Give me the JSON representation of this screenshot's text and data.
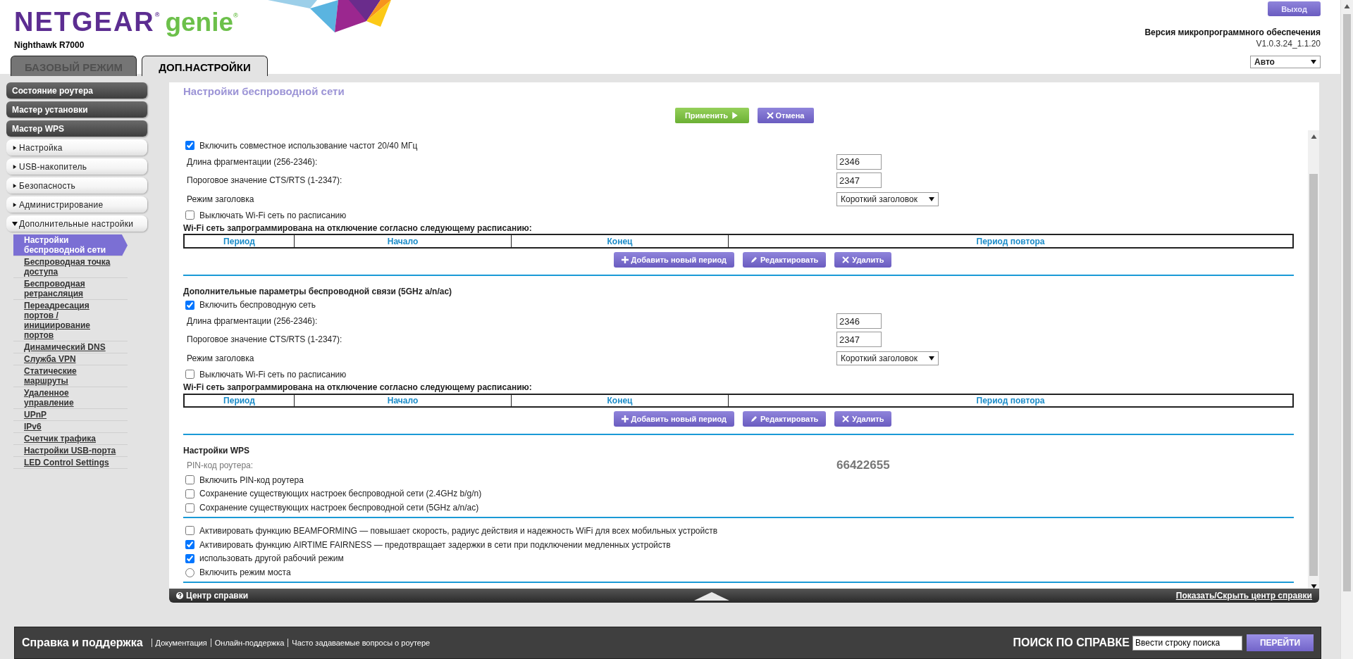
{
  "header": {
    "brand": "NETGEAR$^{®}$",
    "product": "genie$^{®}$",
    "model": "Nighthawk R7000",
    "logout": "Выход",
    "firmware_label": "Версия микропрограммного обеспечения",
    "firmware_version": "V1.0.3.24_1.1.20",
    "language": "Авто"
  },
  "tabs": [
    {
      "label": "БАЗОВЫЙ РЕЖИМ",
      "selected": false
    },
    {
      "label": "ДОП.НАСТРОЙКИ",
      "selected": true
    }
  ],
  "sidebar": {
    "items": [
      {
        "kind": "wizard",
        "label": "Состояние роутера"
      },
      {
        "kind": "wizard",
        "label": "Мастер установки"
      },
      {
        "kind": "wizard",
        "label": "Мастер WPS"
      },
      {
        "kind": "section",
        "label": "Настройка",
        "expanded": false
      },
      {
        "kind": "section",
        "label": "USB-накопитель",
        "expanded": false
      },
      {
        "kind": "section",
        "label": "Безопасность",
        "expanded": false
      },
      {
        "kind": "section",
        "label": "Администрирование",
        "expanded": false
      },
      {
        "kind": "section",
        "label": "Дополнительные настройки",
        "expanded": true,
        "children": [
          {
            "label": "Настройки беспроводной сети",
            "selected": true
          },
          {
            "label": "Беспроводная точка доступа",
            "selected": false
          },
          {
            "label": "Беспроводная ретрансляция",
            "selected": false
          },
          {
            "label": "Переадресация портов / инициирование портов",
            "selected": false
          },
          {
            "label": "Динамический DNS",
            "selected": false
          },
          {
            "label": "Служба VPN",
            "selected": false
          },
          {
            "label": "Статические маршруты",
            "selected": false
          },
          {
            "label": "Удаленное управление",
            "selected": false
          },
          {
            "label": "UPnP",
            "selected": false
          },
          {
            "label": "IPv6",
            "selected": false
          },
          {
            "label": "Счетчик трафика",
            "selected": false
          },
          {
            "label": "Настройки USB-порта",
            "selected": false
          },
          {
            "label": "LED Control Settings",
            "selected": false
          }
        ]
      }
    ]
  },
  "page": {
    "title": "Настройки беспроводной сети",
    "apply": "Применить",
    "cancel": "Отмена",
    "settings": [
      {
        "kind": "checkbox",
        "label": "Включить совместное использование частот 20/40 МГц",
        "checked": true
      },
      {
        "kind": "field",
        "label": "Длина фрагментации (256-2346):",
        "value": "2346"
      },
      {
        "kind": "field",
        "label": "Пороговое значение CTS/RTS (1-2347):",
        "value": "2347"
      },
      {
        "kind": "select",
        "label": "Режим заголовка",
        "value": "Короткий заголовок"
      },
      {
        "kind": "checkbox",
        "label": "Выключать Wi-Fi сеть по расписанию",
        "checked": false
      },
      {
        "kind": "schedule",
        "label": "Wi-Fi сеть запрограммирована на отключение согласно следующему расписанию:",
        "columns": [
          "Период",
          "Начало",
          "Конец",
          "Период повтора"
        ],
        "buttons": [
          {
            "kind": "add",
            "label": "Добавить новый период"
          },
          {
            "kind": "edit",
            "label": "Редактировать"
          },
          {
            "kind": "delete",
            "label": "Удалить"
          }
        ]
      },
      {
        "kind": "divider"
      },
      {
        "kind": "heading",
        "label": "Дополнительные параметры беспроводной связи (5GHz a/n/ac)"
      },
      {
        "kind": "checkbox",
        "label": "Включить беспроводную сеть",
        "checked": true
      },
      {
        "kind": "field",
        "label": "Длина фрагментации (256-2346):",
        "value": "2346"
      },
      {
        "kind": "field",
        "label": "Пороговое значение CTS/RTS (1-2347):",
        "value": "2347"
      },
      {
        "kind": "select",
        "label": "Режим заголовка",
        "value": "Короткий заголовок"
      },
      {
        "kind": "checkbox",
        "label": "Выключать Wi-Fi сеть по расписанию",
        "checked": false
      },
      {
        "kind": "schedule",
        "label": "Wi-Fi сеть запрограммирована на отключение согласно следующему расписанию:",
        "columns": [
          "Период",
          "Начало",
          "Конец",
          "Период повтора"
        ],
        "buttons": [
          {
            "kind": "add",
            "label": "Добавить новый период"
          },
          {
            "kind": "edit",
            "label": "Редактировать"
          },
          {
            "kind": "delete",
            "label": "Удалить"
          }
        ]
      },
      {
        "kind": "divider"
      },
      {
        "kind": "heading",
        "label": "Настройки WPS"
      },
      {
        "kind": "pin",
        "label": "PIN-код роутера:",
        "value": "66422655"
      },
      {
        "kind": "checkbox",
        "label": "Включить PIN-код роутера",
        "checked": false
      },
      {
        "kind": "checkbox",
        "label": "Сохранение существующих настроек беспроводной сети (2.4GHz b/g/n)",
        "checked": false
      },
      {
        "kind": "checkbox",
        "label": "Сохранение существующих настроек беспроводной сети (5GHz a/n/ac)",
        "checked": false
      },
      {
        "kind": "divider"
      },
      {
        "kind": "checkbox",
        "label": "Активировать функцию BEAMFORMING — повышает скорость, радиус действия и надежность WiFi для всех мобильных устройств",
        "checked": false
      },
      {
        "kind": "checkbox",
        "label": "Активировать функцию AIRTIME FAIRNESS — предотвращает задержки в сети при подключении медленных устройств",
        "checked": true
      },
      {
        "kind": "checkbox",
        "label": "использовать другой рабочий режим",
        "checked": true
      },
      {
        "kind": "radio",
        "label": "Включить режим моста",
        "selected": false
      },
      {
        "kind": "divider"
      }
    ]
  },
  "help": {
    "title": "Центр справки",
    "toggle": "Показать/Скрыть центр справки"
  },
  "footer": {
    "title": "Справка и поддержка",
    "links": [
      "Документация",
      "Онлайн-поддержка",
      "Часто задаваемые вопросы о роутере"
    ],
    "search_label": "ПОИСК ПО СПРАВКЕ",
    "search_placeholder": "Ввести строку поиска",
    "search_button": "ПЕРЕЙТИ"
  }
}
